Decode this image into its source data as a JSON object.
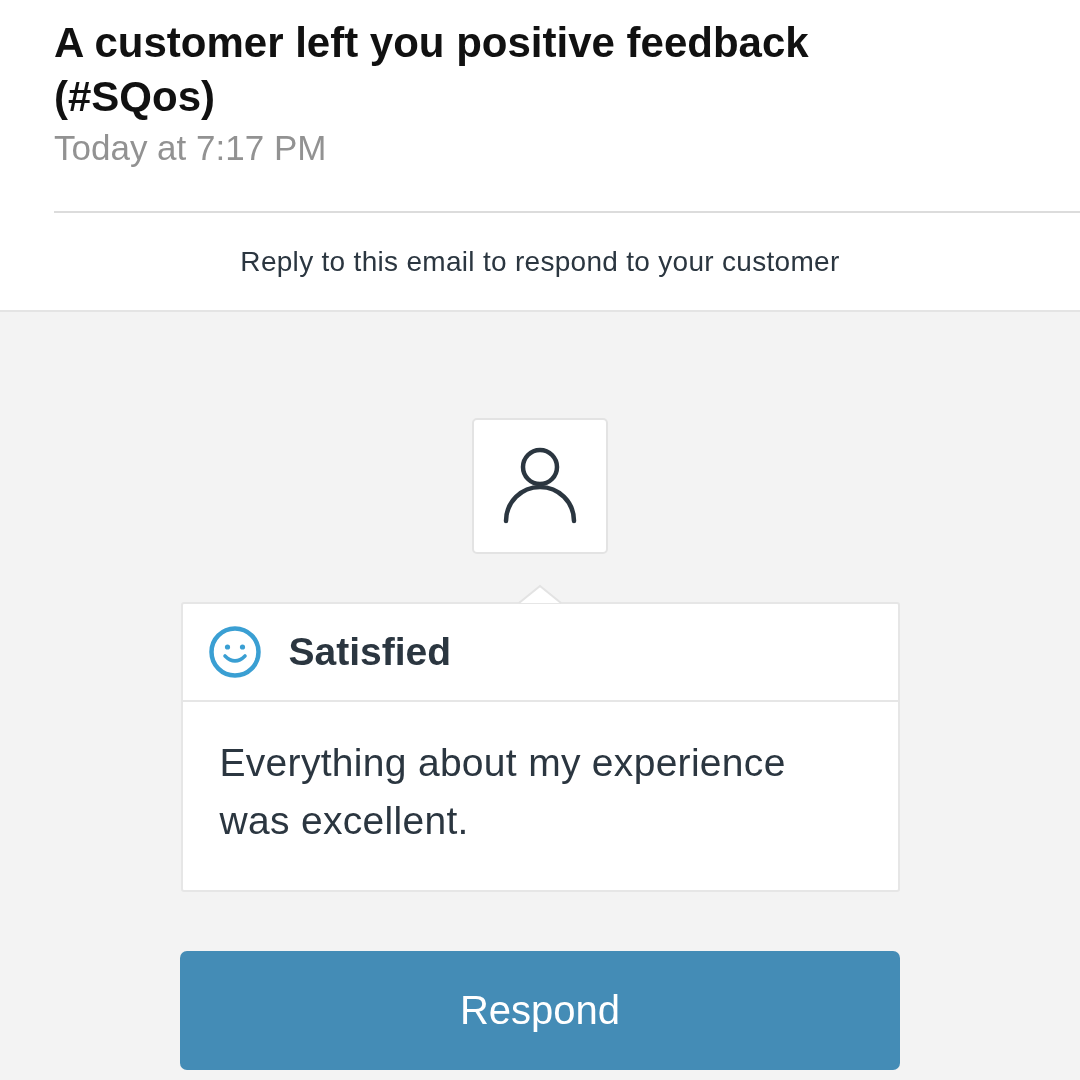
{
  "email": {
    "subject": "A customer left you positive feedback (#SQos)",
    "timestamp": "Today at 7:17 PM"
  },
  "notice": "Reply to this email to respond to your customer",
  "feedback": {
    "rating": "Satisfied",
    "comment": "Everything about my experience was excellent."
  },
  "actions": [
    {
      "label": "Respond"
    }
  ]
}
